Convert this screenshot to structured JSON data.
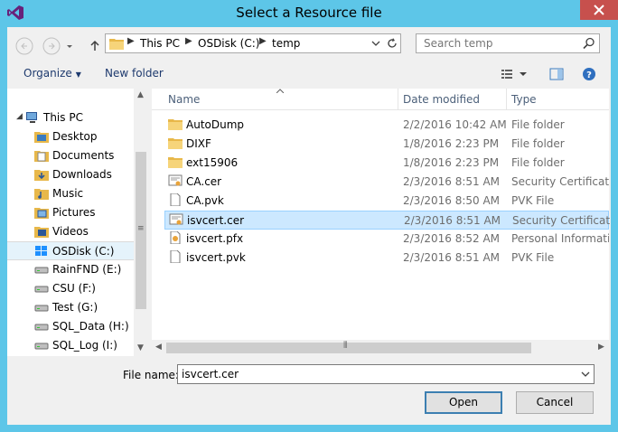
{
  "window": {
    "title": "Select a Resource file"
  },
  "address": {
    "crumbs": [
      "This PC",
      "OSDisk (C:)",
      "temp"
    ]
  },
  "search": {
    "placeholder": "Search temp"
  },
  "toolbar": {
    "organize": "Organize",
    "new_folder": "New folder"
  },
  "columns": {
    "name": "Name",
    "date": "Date modified",
    "type": "Type"
  },
  "nav": {
    "items": [
      {
        "label": "This PC",
        "icon": "computer-icon",
        "level": 0
      },
      {
        "label": "Desktop",
        "icon": "desktop-folder-icon",
        "level": 1
      },
      {
        "label": "Documents",
        "icon": "documents-folder-icon",
        "level": 1
      },
      {
        "label": "Downloads",
        "icon": "downloads-folder-icon",
        "level": 1
      },
      {
        "label": "Music",
        "icon": "music-folder-icon",
        "level": 1
      },
      {
        "label": "Pictures",
        "icon": "pictures-folder-icon",
        "level": 1
      },
      {
        "label": "Videos",
        "icon": "videos-folder-icon",
        "level": 1
      },
      {
        "label": "OSDisk (C:)",
        "icon": "windows-drive-icon",
        "level": 1
      },
      {
        "label": "RainFND (E:)",
        "icon": "drive-icon",
        "level": 1
      },
      {
        "label": "CSU (F:)",
        "icon": "drive-icon",
        "level": 1
      },
      {
        "label": "Test (G:)",
        "icon": "drive-icon",
        "level": 1
      },
      {
        "label": "SQL_Data (H:)",
        "icon": "drive-icon",
        "level": 1
      },
      {
        "label": "SQL_Log (I:)",
        "icon": "drive-icon",
        "level": 1
      }
    ],
    "selected": "OSDisk (C:)"
  },
  "files": [
    {
      "name": "AutoDump",
      "date": "2/2/2016 10:42 AM",
      "type": "File folder",
      "icon": "folder-icon"
    },
    {
      "name": "DIXF",
      "date": "1/8/2016 2:23 PM",
      "type": "File folder",
      "icon": "folder-icon"
    },
    {
      "name": "ext15906",
      "date": "1/8/2016 2:23 PM",
      "type": "File folder",
      "icon": "folder-icon"
    },
    {
      "name": "CA.cer",
      "date": "2/3/2016 8:51 AM",
      "type": "Security Certificate",
      "icon": "certificate-icon"
    },
    {
      "name": "CA.pvk",
      "date": "2/3/2016 8:50 AM",
      "type": "PVK File",
      "icon": "file-icon"
    },
    {
      "name": "isvcert.cer",
      "date": "2/3/2016 8:51 AM",
      "type": "Security Certificate",
      "icon": "certificate-icon"
    },
    {
      "name": "isvcert.pfx",
      "date": "2/3/2016 8:52 AM",
      "type": "Personal Informati...",
      "icon": "pfx-icon"
    },
    {
      "name": "isvcert.pvk",
      "date": "2/3/2016 8:51 AM",
      "type": "PVK File",
      "icon": "file-icon"
    }
  ],
  "selected_file": "isvcert.cer",
  "filename": {
    "label": "File name:",
    "value": "isvcert.cer"
  },
  "buttons": {
    "open": "Open",
    "cancel": "Cancel"
  },
  "colors": {
    "frame": "#5dc6e8",
    "close": "#c7504d",
    "selection": "#cce8ff",
    "link": "#1e3a6e"
  }
}
